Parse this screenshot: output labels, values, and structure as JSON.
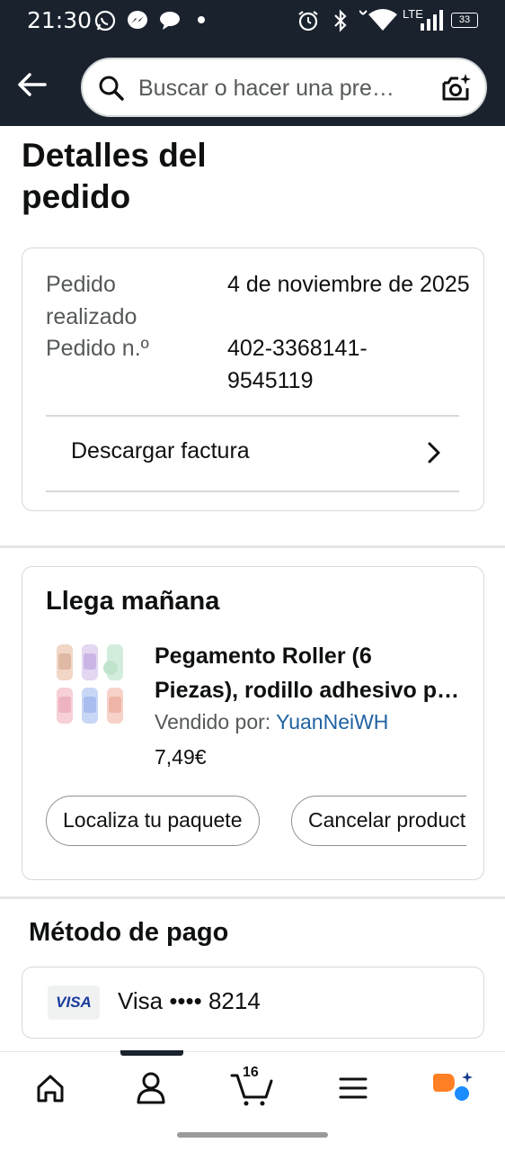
{
  "status_bar": {
    "time": "21:30",
    "network": "LTE",
    "battery": "33"
  },
  "search": {
    "placeholder": "Buscar o hacer una pre…"
  },
  "page": {
    "title": "Detalles del pedido"
  },
  "order": {
    "placed_label": "Pedido realizado",
    "placed_value": "4 de noviembre de 2025",
    "number_label": "Pedido n.º",
    "number_value": "402-3368141-9545119",
    "invoice_label": "Descargar factura"
  },
  "delivery": {
    "title": "Llega mañana",
    "product_title_line1": "Pegamento Roller (6",
    "product_title_line2": "Piezas), rodillo adhesivo para scrapbooking",
    "seller_prefix": "Vendido por: ",
    "seller_name": "YuanNeiWH",
    "price": "7,49€",
    "buttons": [
      "Localiza tu paquete",
      "Cancelar productos"
    ]
  },
  "payment": {
    "title": "Método de pago",
    "card_brand": "VISA",
    "card_text": "Visa •••• 8214"
  },
  "nav": {
    "cart_count": "16",
    "items": [
      "home-icon",
      "account-icon",
      "cart-icon",
      "menu-icon",
      "rufus-icon"
    ]
  },
  "colors": {
    "header_bg": "#1a222e",
    "link": "#2162a1",
    "rufus_orange": "#ff7f24",
    "rufus_blue": "#1a8cff"
  }
}
